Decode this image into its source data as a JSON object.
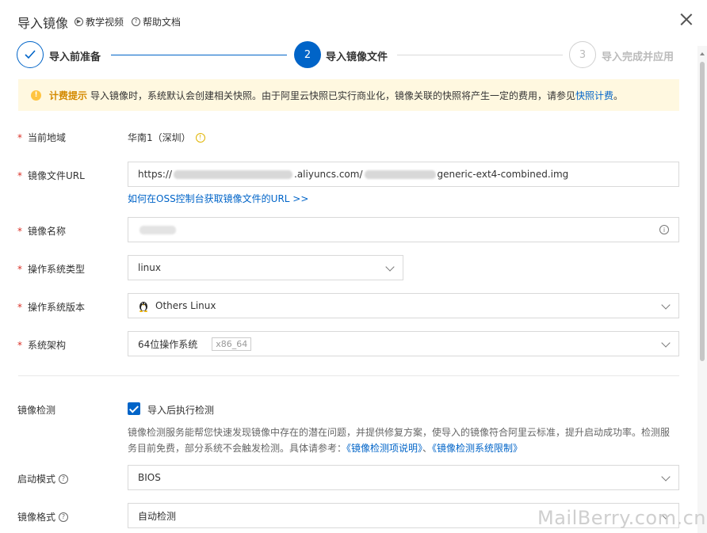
{
  "header": {
    "title": "导入镜像",
    "tutorial_label": "教学视频",
    "help_label": "帮助文档"
  },
  "steps": [
    {
      "label": "导入前准备",
      "state": "done"
    },
    {
      "num": "2",
      "label": "导入镜像文件",
      "state": "active"
    },
    {
      "num": "3",
      "label": "导入完成并应用",
      "state": "pending"
    }
  ],
  "notice": {
    "title": "计费提示",
    "text": "导入镜像时，系统默认会创建相关快照。由于阿里云快照已实行商业化，镜像关联的快照将产生一定的费用，请参见",
    "link": "快照计费",
    "end": "。"
  },
  "form": {
    "region": {
      "label": "当前地域",
      "value": "华南1（深圳）"
    },
    "url": {
      "label": "镜像文件URL",
      "prefix": "https://",
      "middle": ".aliyuncs.com/",
      "suffix": "generic-ext4-combined.img",
      "helper": "如何在OSS控制台获取镜像文件的URL >>"
    },
    "name": {
      "label": "镜像名称"
    },
    "os_type": {
      "label": "操作系统类型",
      "value": "linux"
    },
    "os_version": {
      "label": "操作系统版本",
      "value": "Others Linux"
    },
    "arch": {
      "label": "系统架构",
      "value": "64位操作系统",
      "tag": "x86_64"
    },
    "check": {
      "label": "镜像检测",
      "checkbox_label": "导入后执行检测",
      "checked": true,
      "desc_line1": "镜像检测服务能帮您快速发现镜像中存在的潜在问题，并提供修复方案，使导入的镜像符合阿里云标准，提升启动成功率。检测服",
      "desc_line2": "务目前免费，部分系统不会触发检测。具体请参考：",
      "link1": "《镜像检测项说明》",
      "sep": "、",
      "link2": "《镜像检测系统限制》"
    },
    "boot": {
      "label": "启动模式",
      "value": "BIOS"
    },
    "format": {
      "label": "镜像格式",
      "value": "自动检测"
    }
  },
  "watermark": "MailBerry.com.cn",
  "colors": {
    "accent": "#0064c8",
    "warning_bg": "#fff8e0",
    "required": "#d93026"
  }
}
